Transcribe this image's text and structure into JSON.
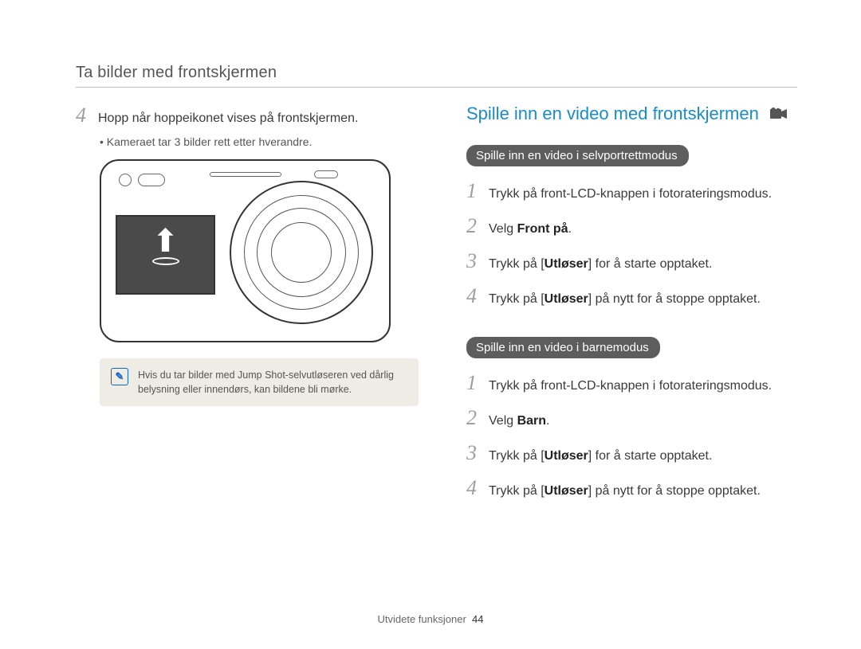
{
  "section_title": "Ta bilder med frontskjermen",
  "left": {
    "step4_num": "4",
    "step4_text": "Hopp når hoppeikonet vises på frontskjermen.",
    "bullet": "Kameraet tar 3 bilder rett etter hverandre.",
    "note_text": "Hvis du tar bilder med Jump Shot-selvutløseren ved dårlig belysning eller innendørs, kan bildene bli mørke."
  },
  "right": {
    "heading": "Spille inn en video med frontskjermen",
    "sub1_title": "Spille inn en video i selvportrettmodus",
    "sub1": {
      "s1_num": "1",
      "s1_text": "Trykk på front-LCD-knappen i fotorateringsmodus.",
      "s2_num": "2",
      "s2_pre": "Velg ",
      "s2_bold": "Front på",
      "s2_post": ".",
      "s3_num": "3",
      "s3_pre": "Trykk på [",
      "s3_bold": "Utløser",
      "s3_post": "] for å starte opptaket.",
      "s4_num": "4",
      "s4_pre": "Trykk på [",
      "s4_bold": "Utløser",
      "s4_post": "] på nytt for å stoppe opptaket."
    },
    "sub2_title": "Spille inn en video i barnemodus",
    "sub2": {
      "s1_num": "1",
      "s1_text": "Trykk på front-LCD-knappen i fotorateringsmodus.",
      "s2_num": "2",
      "s2_pre": "Velg ",
      "s2_bold": "Barn",
      "s2_post": ".",
      "s3_num": "3",
      "s3_pre": "Trykk på [",
      "s3_bold": "Utløser",
      "s3_post": "] for å starte opptaket.",
      "s4_num": "4",
      "s4_pre": "Trykk på [",
      "s4_bold": "Utløser",
      "s4_post": "] på nytt for å stoppe opptaket."
    }
  },
  "footer": {
    "label": "Utvidete funksjoner",
    "page": "44"
  }
}
